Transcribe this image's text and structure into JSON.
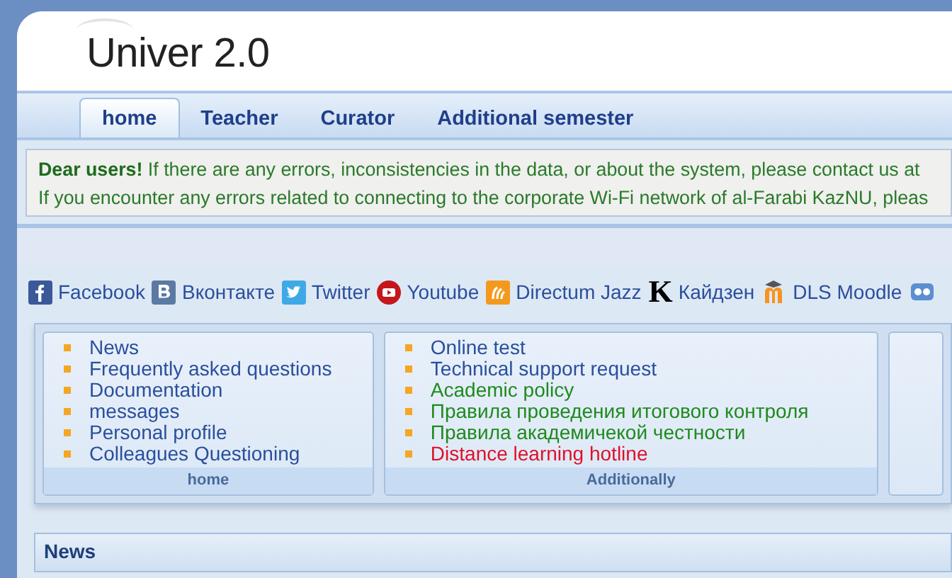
{
  "site": {
    "title": "Univer 2.0"
  },
  "tabs": [
    {
      "label": "home",
      "selected": true
    },
    {
      "label": "Teacher",
      "selected": false
    },
    {
      "label": "Curator",
      "selected": false
    },
    {
      "label": "Additional semester",
      "selected": false
    }
  ],
  "notice": {
    "lead": "Dear users!",
    "lines": [
      "If there are any errors, inconsistencies in the data, or about the system, please contact us at",
      "If you encounter any errors related to connecting to the corporate Wi-Fi network of al-Farabi KazNU, pleas"
    ]
  },
  "social_links": [
    {
      "kind": "facebook",
      "label": "Facebook"
    },
    {
      "kind": "vk",
      "label": "Вконтакте"
    },
    {
      "kind": "twitter",
      "label": "Twitter"
    },
    {
      "kind": "youtube",
      "label": "Youtube"
    },
    {
      "kind": "directum",
      "label": "Directum Jazz"
    },
    {
      "kind": "letter",
      "icon_text": "K",
      "label": "Кайдзен"
    },
    {
      "kind": "moodle",
      "label": "DLS Moodle"
    },
    {
      "kind": "owl"
    }
  ],
  "menus": [
    {
      "title": "home",
      "items": [
        {
          "label": "News",
          "color": "#2a4f9c"
        },
        {
          "label": "Frequently asked questions",
          "color": "#2a4f9c"
        },
        {
          "label": "Documentation",
          "color": "#2a4f9c"
        },
        {
          "label": "messages",
          "color": "#2a4f9c"
        },
        {
          "label": "Personal profile",
          "color": "#2a4f9c"
        },
        {
          "label": "Colleagues Questioning",
          "color": "#2a4f9c"
        }
      ]
    },
    {
      "title": "Additionally",
      "items": [
        {
          "label": "Online test",
          "color": "#2a4f9c"
        },
        {
          "label": "Technical support request",
          "color": "#2a4f9c"
        },
        {
          "label": "Academic policy",
          "color": "#1f8a1f"
        },
        {
          "label": "Правила проведения итогового контроля",
          "color": "#1f8a1f"
        },
        {
          "label": "Правила академичекой честности",
          "color": "#1f8a1f"
        },
        {
          "label": "Distance learning hotline",
          "color": "#e0102a"
        }
      ]
    }
  ],
  "news": {
    "title": "News"
  }
}
